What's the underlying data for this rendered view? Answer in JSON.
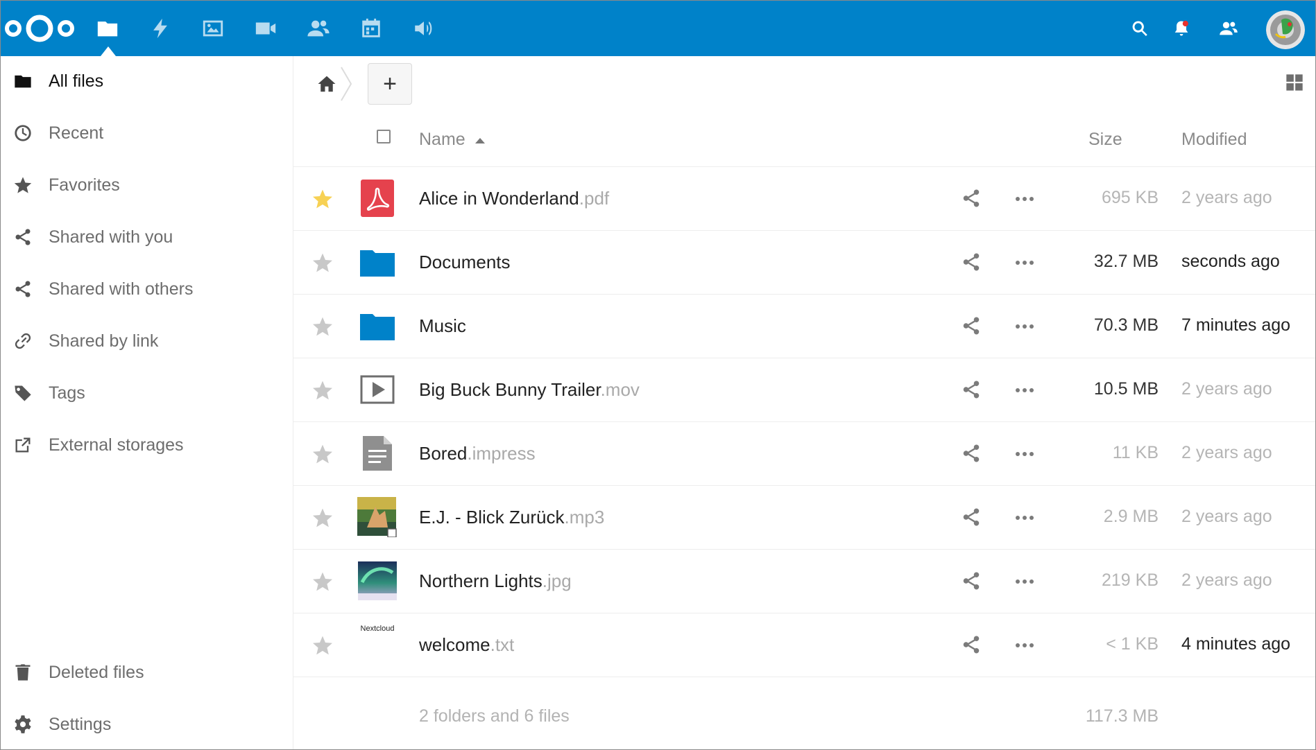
{
  "header": {
    "apps": [
      "files-icon",
      "activity-icon",
      "gallery-icon",
      "video-icon",
      "contacts-icon",
      "calendar-icon",
      "audio-icon"
    ],
    "right_icons": [
      "search-icon",
      "notifications-icon",
      "contacts-menu-icon"
    ],
    "accent": "#0082c9"
  },
  "sidebar": {
    "items": [
      {
        "label": "All files",
        "icon": "folder-icon"
      },
      {
        "label": "Recent",
        "icon": "clock-icon"
      },
      {
        "label": "Favorites",
        "icon": "star-icon"
      },
      {
        "label": "Shared with you",
        "icon": "share-icon"
      },
      {
        "label": "Shared with others",
        "icon": "share-icon"
      },
      {
        "label": "Shared by link",
        "icon": "link-icon"
      },
      {
        "label": "Tags",
        "icon": "tag-icon"
      },
      {
        "label": "External storages",
        "icon": "external-icon"
      }
    ],
    "bottom": [
      {
        "label": "Deleted files",
        "icon": "trash-icon"
      },
      {
        "label": "Settings",
        "icon": "gear-icon"
      }
    ]
  },
  "toolbar": {
    "add_label": "+"
  },
  "table": {
    "headers": {
      "name": "Name",
      "size": "Size",
      "modified": "Modified"
    },
    "rows": [
      {
        "name": "Alice in Wonderland",
        "ext": ".pdf",
        "size": "695 KB",
        "modified": "2 years ago",
        "type": "pdf",
        "favorite": true
      },
      {
        "name": "Documents",
        "ext": "",
        "size": "32.7 MB",
        "modified": "seconds ago",
        "type": "folder",
        "favorite": false
      },
      {
        "name": "Music",
        "ext": "",
        "size": "70.3 MB",
        "modified": "7 minutes ago",
        "type": "folder",
        "favorite": false
      },
      {
        "name": "Big Buck Bunny Trailer",
        "ext": ".mov",
        "size": "10.5 MB",
        "modified": "2 years ago",
        "type": "video",
        "favorite": false
      },
      {
        "name": "Bored",
        "ext": ".impress",
        "size": "11 KB",
        "modified": "2 years ago",
        "type": "document",
        "favorite": false
      },
      {
        "name": "E.J. - Blick Zurück",
        "ext": ".mp3",
        "size": "2.9 MB",
        "modified": "2 years ago",
        "type": "audio",
        "favorite": false
      },
      {
        "name": "Northern Lights",
        "ext": ".jpg",
        "size": "219 KB",
        "modified": "2 years ago",
        "type": "image",
        "favorite": false
      },
      {
        "name": "welcome",
        "ext": ".txt",
        "size": "< 1 KB",
        "modified": "4 minutes ago",
        "type": "text",
        "favorite": false,
        "thumb_text": "Nextcloud"
      }
    ],
    "summary": {
      "label": "2 folders and 6 files",
      "size": "117.3 MB"
    }
  }
}
